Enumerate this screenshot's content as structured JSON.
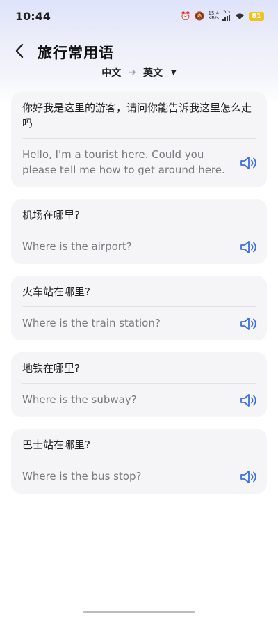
{
  "status_bar": {
    "time": "10:44",
    "speed_top": "15.4",
    "speed_bottom": "KB/s",
    "network": "5G",
    "battery": "81"
  },
  "header": {
    "title": "旅行常用语",
    "source_lang": "中文",
    "target_lang": "英文"
  },
  "phrases": [
    {
      "zh": "你好我是这里的游客，请问你能告诉我这里怎么走吗",
      "en": "Hello, I'm a tourist here. Could you please tell me how to get around here."
    },
    {
      "zh": "机场在哪里?",
      "en": "Where is the airport?"
    },
    {
      "zh": "火车站在哪里?",
      "en": "Where is the train station?"
    },
    {
      "zh": "地铁在哪里?",
      "en": "Where is the subway?"
    },
    {
      "zh": "巴士站在哪里?",
      "en": "Where is the bus stop?"
    }
  ],
  "colors": {
    "accent": "#3b6fe0",
    "battery": "#f2c21b"
  }
}
